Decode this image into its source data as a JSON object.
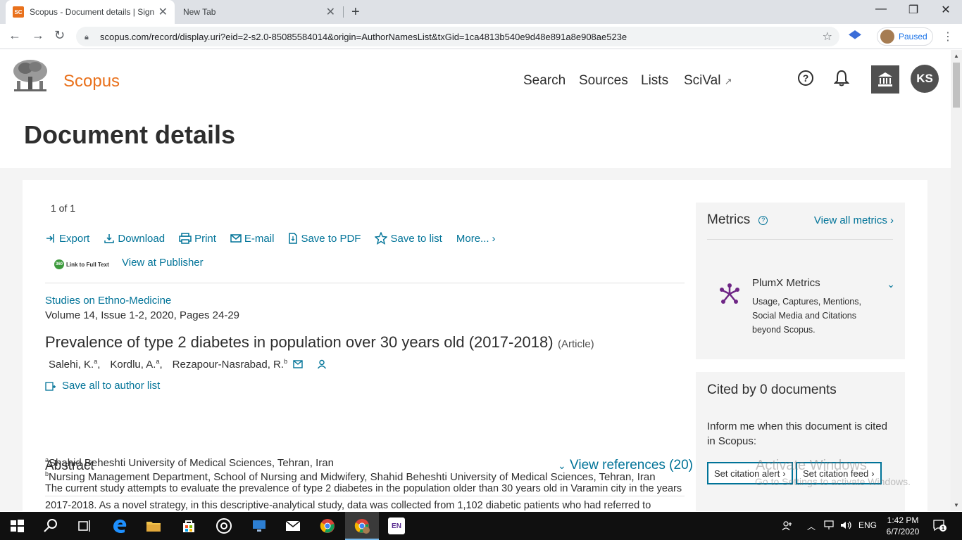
{
  "browser": {
    "tabs": [
      {
        "title": "Scopus - Document details | Sign",
        "favicon": "SC"
      },
      {
        "title": "New Tab"
      }
    ],
    "new_tab": "+",
    "url": "scopus.com/record/display.uri?eid=2-s2.0-85085584014&origin=AuthorNamesList&txGid=1ca4813b540e9d48e891a8e908ae523e",
    "profile_status": "Paused"
  },
  "header": {
    "brand": "Scopus",
    "nav": [
      "Search",
      "Sources",
      "Lists",
      "SciVal"
    ],
    "scival_arrow": "↗",
    "avatar_initials": "KS",
    "page_title": "Document details"
  },
  "document": {
    "pager": "1 of 1",
    "actions": {
      "export": "Export",
      "download": "Download",
      "print": "Print",
      "email": "E-mail",
      "save_pdf": "Save to PDF",
      "save_list": "Save to list",
      "more": "More..."
    },
    "full_text_badge": "Link to Full Text",
    "full_text_badge_num": "360",
    "view_publisher": "View at Publisher",
    "source_title": "Studies on Ethno-Medicine",
    "source_meta": "Volume 14, Issue 1-2, 2020, Pages 24-29",
    "title": "Prevalence of type 2 diabetes in population over 30 years old (2017-2018)",
    "type": "(Article)",
    "authors": [
      {
        "name": "Salehi, K.",
        "sup": "a",
        "sep": ","
      },
      {
        "name": "Kordlu, A.",
        "sup": "a",
        "sep": ","
      },
      {
        "name": "Rezapour-Nasrabad, R.",
        "sup": "b",
        "sep": ""
      }
    ],
    "save_authors": "Save all to author list",
    "affiliations": [
      {
        "sup": "a",
        "text": "Shahid Beheshti University of Medical Sciences, Tehran, Iran"
      },
      {
        "sup": "b",
        "text": "Nursing Management Department, School of Nursing and Midwifery, Shahid Beheshti University of Medical Sciences, Tehran, Iran"
      }
    ],
    "abstract_heading": "Abstract",
    "view_references": "View references (20)",
    "abstract_text": "The current study attempts to evaluate the prevalence of type 2 diabetes in the population older than 30 years old in Varamin city in the years 2017-2018. As a novel strategy, in this descriptive-analytical study, data was collected from 1,102 diabetic patients who had referred to"
  },
  "sidebar": {
    "metrics_heading": "Metrics",
    "metrics_help": "?",
    "view_all_metrics": "View all metrics",
    "plumx_title": "PlumX Metrics",
    "plumx_desc": "Usage, Captures, Mentions, Social Media and Citations beyond Scopus.",
    "cited_heading": "Cited by 0 documents",
    "cited_text": "Inform me when this document is cited in Scopus:",
    "set_alert": "Set citation alert",
    "set_feed": "Set citation feed"
  },
  "watermark": {
    "line1": "Activate Windows",
    "line2": "Go to Settings to activate Windows."
  },
  "taskbar": {
    "language": "ENG",
    "time": "1:42 PM",
    "date": "6/7/2020",
    "app_en": "EN",
    "notifications": "1"
  },
  "colors": {
    "brand": "#e9711c",
    "link": "#007398",
    "text": "#2e2e2e"
  }
}
